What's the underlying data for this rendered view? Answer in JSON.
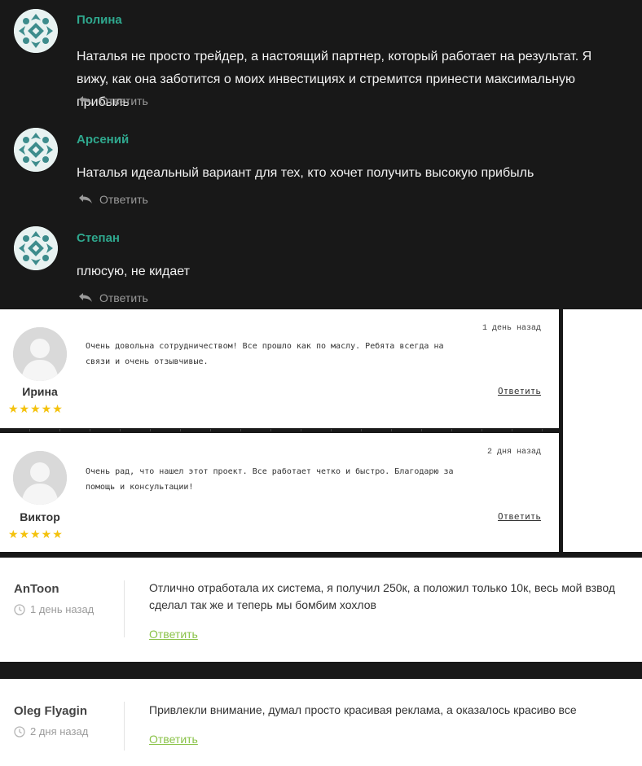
{
  "dark_comments": [
    {
      "author": "Полина",
      "text": "Наталья не просто трейдер, а настоящий партнер, который работает на результат. Я вижу, как она заботится о моих инвестициях и стремится принести максимальную прибыль",
      "reply": "Ответить"
    },
    {
      "author": "Арсений",
      "text": "Наталья идеальный вариант для тех, кто хочет получить высокую прибыль",
      "reply": "Ответить"
    },
    {
      "author": "Степан",
      "text": "плюсую, не кидает",
      "reply": "Ответить"
    }
  ],
  "review_cards": [
    {
      "name": "Ирина",
      "stars": "★★★★★",
      "date": "1 день назад",
      "text": "Очень довольна сотрудничеством! Все прошло как по маслу. Ребята всегда на связи и очень отзывчивые.",
      "reply": "Ответить"
    },
    {
      "name": "Виктор",
      "stars": "★★★★★",
      "date": "2 дня назад",
      "text": "Очень рад, что нашел этот проект. Все работает четко и быстро. Благодарю за помощь и консультации!",
      "reply": "Ответить"
    }
  ],
  "light_comments": [
    {
      "author": "AnToon",
      "date": "1 день назад",
      "text": "Отлично отработала их система, я получил 250к, а положил только 10к, весь мой взвод сделал так же и теперь мы бомбим хохлов",
      "reply": "Ответить"
    },
    {
      "author": "Oleg Flyagin",
      "date": "2 дня назад",
      "text": "Привлекли внимание, думал просто красивая реклама, а оказалось красиво все",
      "reply": "Ответить"
    }
  ],
  "colors": {
    "dark_bg": "#181818",
    "author_accent": "#2fa88e",
    "star": "#f4c20d",
    "reply_link_light": "#8bc34a"
  },
  "icons": {
    "reply": "reply-arrow-icon",
    "clock": "clock-icon",
    "avatar_pattern": "ornament-avatar-icon",
    "avatar_placeholder": "user-placeholder-icon"
  }
}
